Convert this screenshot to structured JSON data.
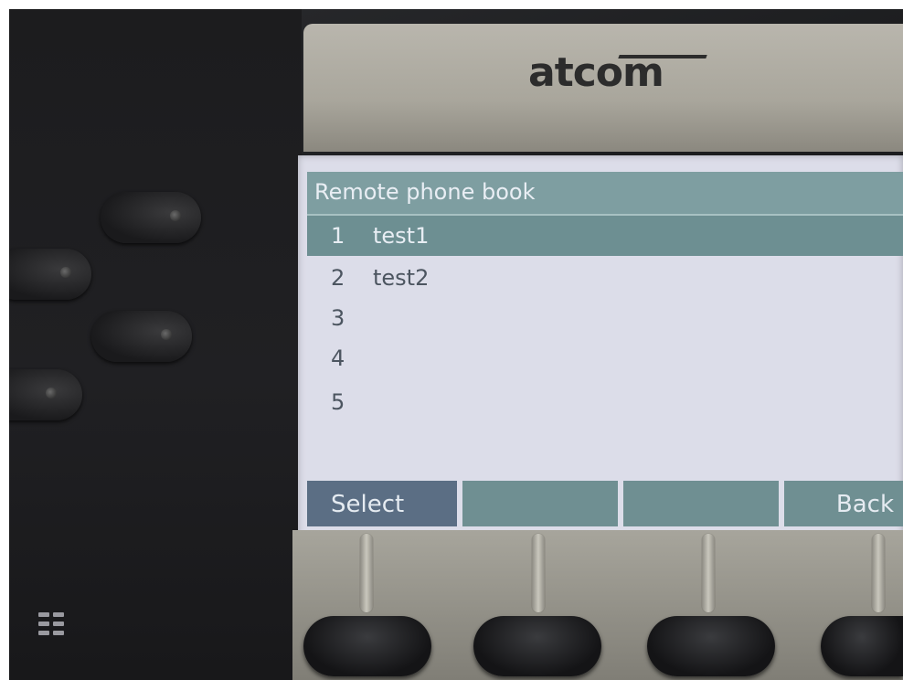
{
  "device": {
    "brand": "atcom"
  },
  "screen": {
    "title": "Remote phone book",
    "entries": [
      {
        "number": "1",
        "name": "test1",
        "selected": true
      },
      {
        "number": "2",
        "name": "test2",
        "selected": false
      },
      {
        "number": "3",
        "name": "",
        "selected": false
      },
      {
        "number": "4",
        "name": "",
        "selected": false
      },
      {
        "number": "5",
        "name": "",
        "selected": false
      }
    ],
    "softkeys": [
      "Select",
      "",
      "",
      "Back"
    ]
  },
  "colors": {
    "screen_bg": "#dcdde9",
    "title_bar": "#7e9ea1",
    "selected_row": "#6d8f92",
    "softkey": "#6f8f92",
    "softkey_active": "#5b6e84"
  }
}
